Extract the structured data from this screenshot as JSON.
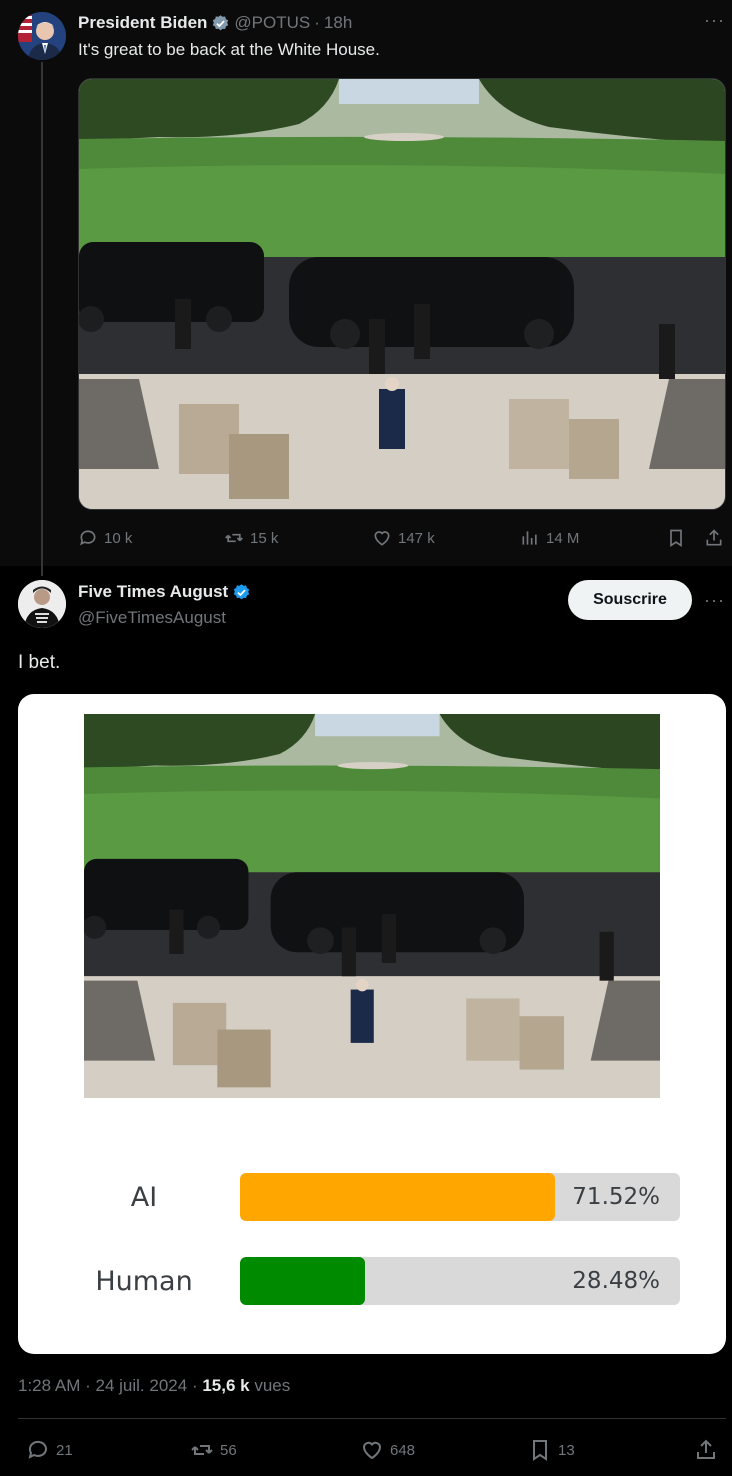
{
  "parent_tweet": {
    "author_name": "President Biden",
    "handle": "@POTUS",
    "separator": "·",
    "time": "18h",
    "text": "It's great to be back at the White House.",
    "stats": {
      "replies": "10 k",
      "reposts": "15 k",
      "likes": "147 k",
      "views": "14 M"
    }
  },
  "main_tweet": {
    "author_name": "Five Times August",
    "handle": "@FiveTimesAugust",
    "subscribe_label": "Souscrire",
    "text": "I bet.",
    "poll": [
      {
        "label": "AI",
        "percent_text": "71.52%",
        "value": 71.52,
        "color": "#ffa600"
      },
      {
        "label": "Human",
        "percent_text": "28.48%",
        "value": 28.48,
        "color": "#008a00"
      }
    ],
    "meta": {
      "time": "1:28 AM",
      "dot": "·",
      "date": "24 juil. 2024",
      "views_count": "15,6 k",
      "views_label": "vues"
    },
    "stats": {
      "replies": "21",
      "reposts": "56",
      "likes": "648",
      "bookmarks": "13"
    }
  },
  "colors": {
    "verified_blue": "#1d9bf0",
    "background": "#000000",
    "muted_text": "#71767b"
  }
}
